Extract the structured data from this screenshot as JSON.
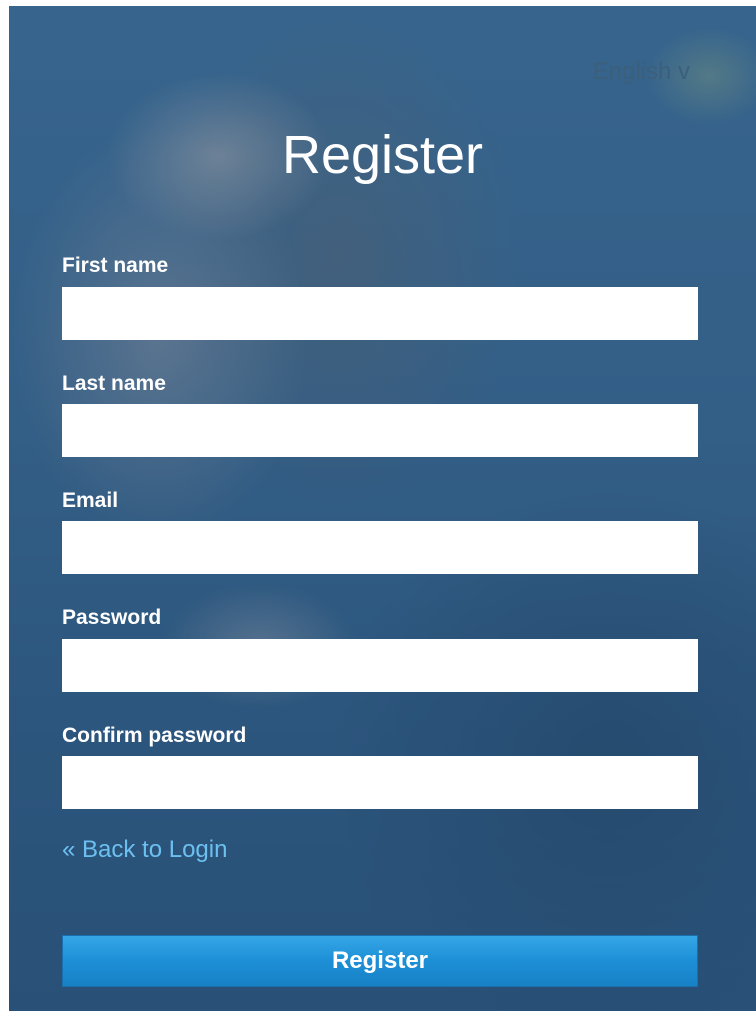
{
  "header": {
    "language_selector": "English v",
    "title": "Register"
  },
  "form": {
    "fields": [
      {
        "label": "First name",
        "value": "",
        "placeholder": ""
      },
      {
        "label": "Last name",
        "value": "",
        "placeholder": ""
      },
      {
        "label": "Email",
        "value": "",
        "placeholder": ""
      },
      {
        "label": "Password",
        "value": "",
        "placeholder": ""
      },
      {
        "label": "Confirm password",
        "value": "",
        "placeholder": ""
      }
    ],
    "back_link": "« Back to Login",
    "submit_label": "Register"
  },
  "colors": {
    "link": "#6cc0f0",
    "button": "#1d8fd6",
    "background": "#3a6283"
  }
}
